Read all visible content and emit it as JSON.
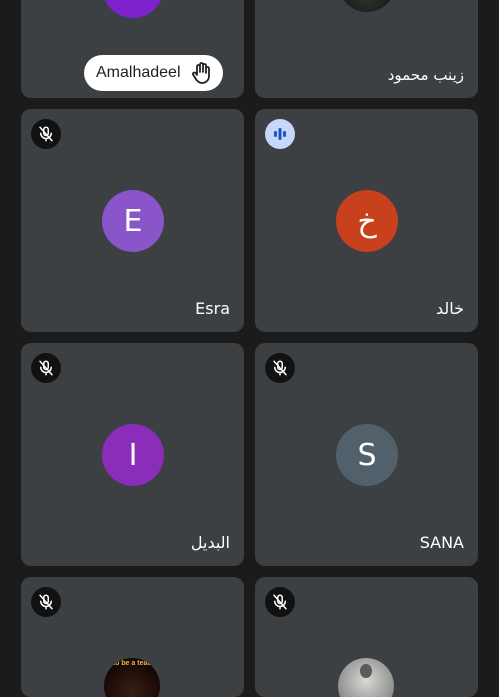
{
  "participants": [
    {
      "name": "Amalhadeel",
      "hand_raised": true,
      "avatar_color": "#7e22ce"
    },
    {
      "name": "زينب محمود",
      "avatar_type": "photo"
    },
    {
      "name": "Esra",
      "initial": "E",
      "avatar_color": "#8a55c9",
      "muted": true
    },
    {
      "name": "خالد",
      "initial": "خ",
      "avatar_color": "#c8401c",
      "speaking": true
    },
    {
      "name": "البديل",
      "initial": "I",
      "avatar_color": "#8a2db8",
      "muted": true
    },
    {
      "name": "SANA",
      "initial": "S",
      "avatar_color": "#51606b",
      "muted": true
    },
    {
      "name": "",
      "avatar_type": "photo",
      "photo_text": "to be a teac",
      "muted": true
    },
    {
      "name": "",
      "avatar_type": "photo",
      "muted": true
    }
  ],
  "icons": {
    "mic_off": "mic-off-icon",
    "hand": "raised-hand-icon",
    "speaking": "audio-level-icon"
  },
  "colors": {
    "background": "#1b1b1c",
    "tile": "#3c4043",
    "speaking_badge": "#c6d7fb",
    "speaking_bars": "#1a56c4"
  }
}
